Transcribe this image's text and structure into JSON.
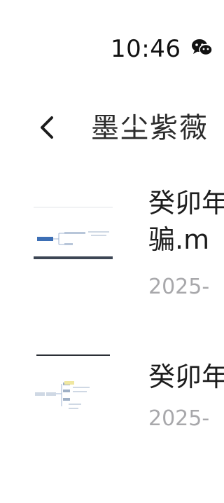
{
  "status_bar": {
    "time": "10:46",
    "notification_icon": "wechat-icon"
  },
  "header": {
    "back_icon": "chevron-left-icon",
    "title": "墨尘紫薇"
  },
  "files": [
    {
      "name_line1": "癸卯年",
      "name_line2": "骗.m",
      "date": "2025-",
      "thumbnail_icon": "mindmap-thumbnail"
    },
    {
      "name_line1": "癸卯年",
      "date": "2025-",
      "thumbnail_icon": "mindmap-thumbnail"
    }
  ]
}
